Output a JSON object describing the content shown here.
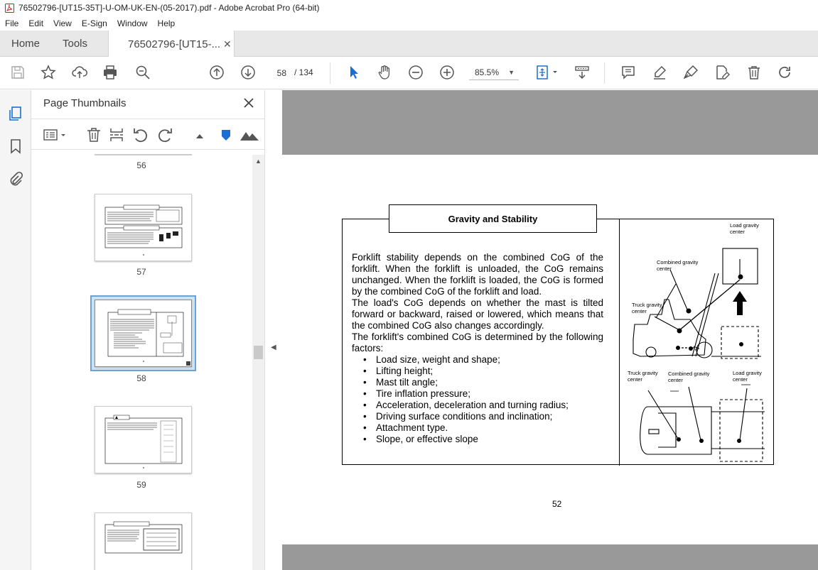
{
  "window": {
    "title": "76502796-[UT15-35T]-U-OM-UK-EN-(05-2017).pdf - Adobe Acrobat Pro (64-bit)"
  },
  "menu": [
    "File",
    "Edit",
    "View",
    "E-Sign",
    "Window",
    "Help"
  ],
  "tabs": {
    "home": "Home",
    "tools": "Tools",
    "doc": "76502796-[UT15-..."
  },
  "toolbar": {
    "page_current": "58",
    "page_total": "/  134",
    "zoom": "85.5%"
  },
  "panel": {
    "title": "Page Thumbnails",
    "thumbs": [
      {
        "label": "56"
      },
      {
        "label": "57"
      },
      {
        "label": "58",
        "selected": true
      },
      {
        "label": "59"
      }
    ]
  },
  "document": {
    "section_title": "Gravity and Stability",
    "paragraphs": [
      "Forklift stability depends on the combined CoG of the forklift. When the forklift is unloaded, the CoG remains unchanged. When the forklift is loaded, the CoG is formed by the combined CoG of the forklift and load.",
      "The load's CoG depends on whether the mast is tilted forward or backward, raised or lowered, which means that the combined CoG also changes accordingly.",
      "The forklift's combined CoG is determined by the following factors:"
    ],
    "factors": [
      "Load size, weight and shape;",
      "Lifting height;",
      "Mast tilt angle;",
      "Tire inflation pressure;",
      "Acceleration, deceleration and turning radius;",
      "Driving surface conditions and inclination;",
      "Attachment type.",
      "Slope, or effective slope"
    ],
    "diagram_labels": {
      "load_gravity_center_1": "Load gravity",
      "load_gravity_center_2": "center",
      "combined_gravity_center_1": "Combined gravity",
      "combined_gravity_center_2": "center",
      "truck_gravity_center_1": "Truck gravity",
      "truck_gravity_center_2": "center"
    },
    "page_number": "52"
  }
}
